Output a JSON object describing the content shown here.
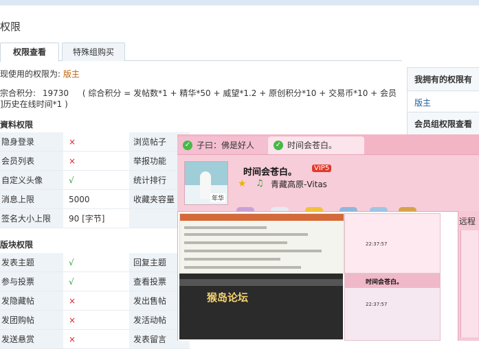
{
  "page": {
    "title": "权限"
  },
  "tabs": {
    "active": "权限查看",
    "inactive": "特殊组购买"
  },
  "info": {
    "current_label": "现使用的权限为:",
    "current_value": "版主",
    "score_label": "宗合积分:",
    "score_value": "19730",
    "formula_line1": "( 综合积分 = 发帖数*1 + 精华*50 + 威望*1.2 + 原创积分*10 + 交易币*10 + 会员",
    "formula_line2": "]历史在线时间*1 )"
  },
  "sections": {
    "data_perm": "資料权限",
    "board_perm": "版块权限"
  },
  "data_rows": [
    {
      "name": "隐身登录",
      "value": "×",
      "kind": "x",
      "name2": "浏览帖子"
    },
    {
      "name": "会员列表",
      "value": "×",
      "kind": "x",
      "name2": "举报功能"
    },
    {
      "name": "自定义头像",
      "value": "√",
      "kind": "y",
      "name2": "统计排行"
    },
    {
      "name": "消息上限",
      "value": "5000",
      "kind": "t",
      "name2": "收藏夹容量"
    },
    {
      "name": "签名大小上限",
      "value": "90 [字节]",
      "kind": "t",
      "name2": ""
    }
  ],
  "board_rows": [
    {
      "name": "发表主题",
      "value": "√",
      "kind": "y",
      "name2": "回复主题"
    },
    {
      "name": "参与投票",
      "value": "√",
      "kind": "y",
      "name2": "查看投票"
    },
    {
      "name": "发隐藏帖",
      "value": "×",
      "kind": "x",
      "name2": "发出售帖"
    },
    {
      "name": "发团购帖",
      "value": "×",
      "kind": "x",
      "name2": "发活动帖"
    },
    {
      "name": "发送悬赏",
      "value": "×",
      "kind": "x",
      "name2": "发表留言"
    }
  ],
  "sidebar": {
    "own_title": "我拥有的权限有",
    "own_value": "版主",
    "group_title": "会员组权限查看"
  },
  "qq": {
    "tab1": "子曰：佛是好人",
    "tab2": "时间会苍白。",
    "nick": "时间会苍白。",
    "vip": "VIP5",
    "signature": "青藏高原-Vitas",
    "avatar_tag": "年华",
    "side_label": "远程",
    "forum_title": "猴岛论坛",
    "chat_nick": "时间会苍白。",
    "chat_time": "22:37:57"
  },
  "colors": {
    "accent": "#c0630c",
    "link": "#1e5fa0",
    "qq_pink": "#f6c8d6"
  }
}
